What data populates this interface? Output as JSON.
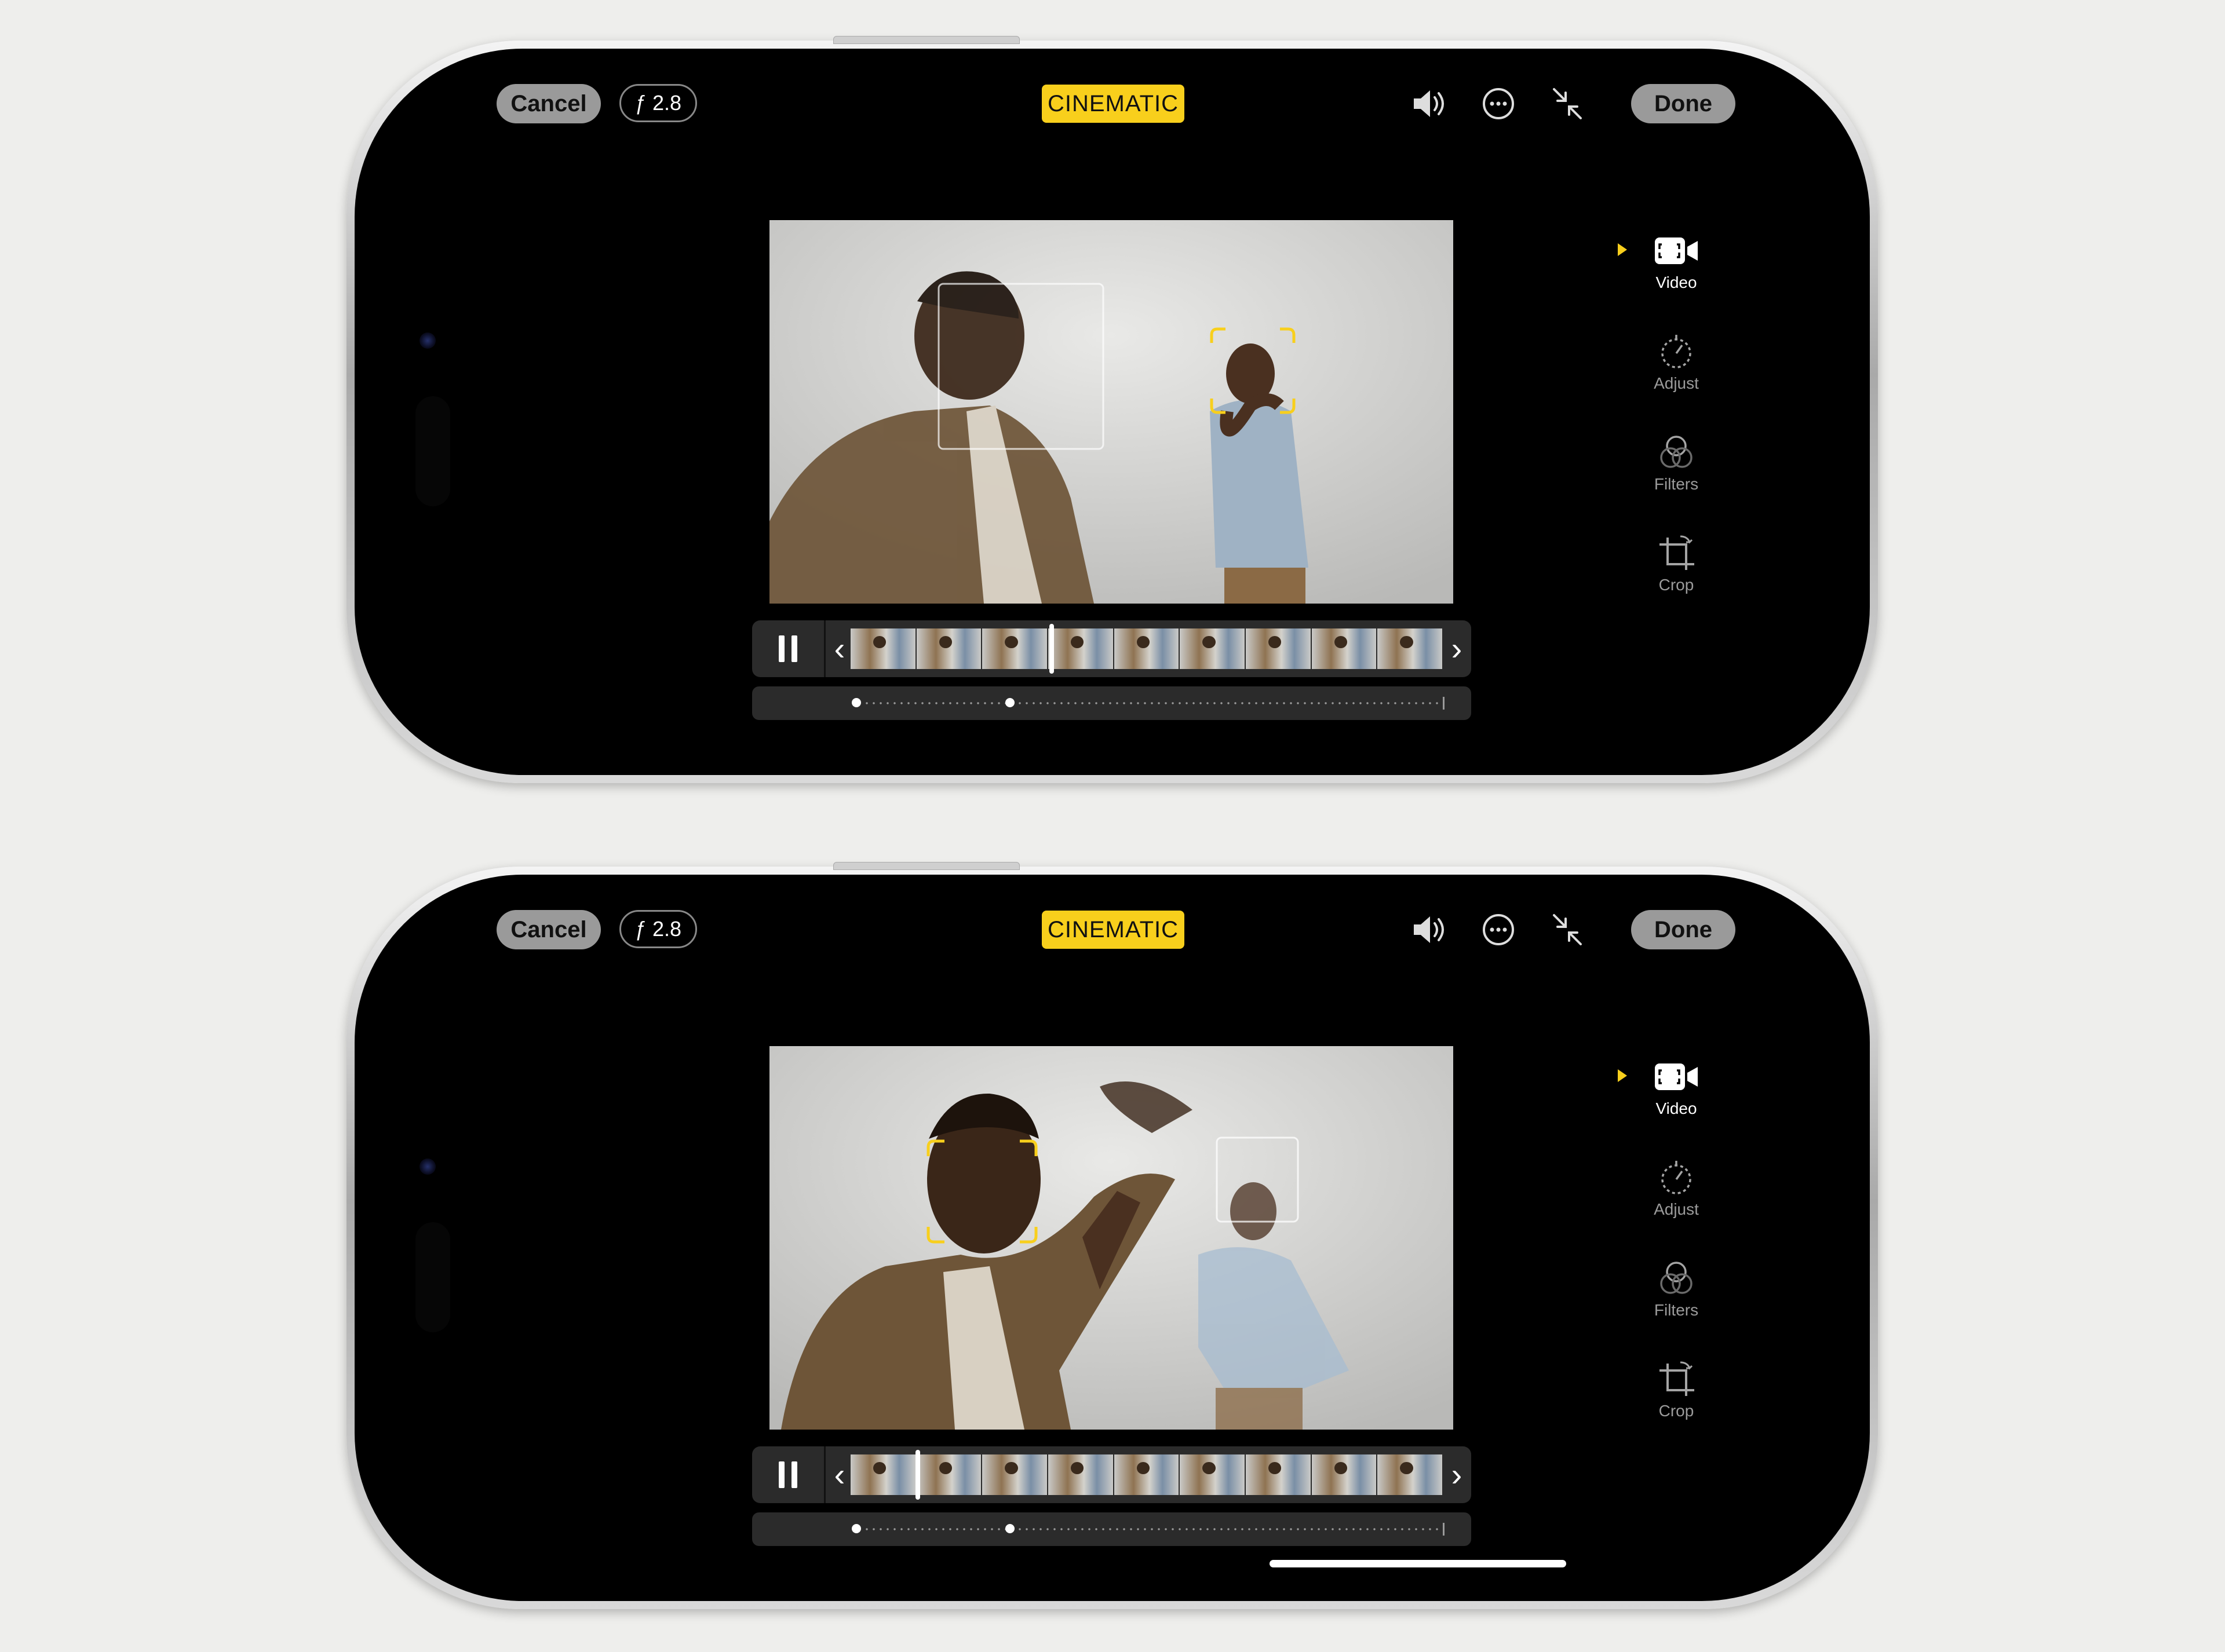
{
  "header": {
    "cancel_label": "Cancel",
    "aperture_label": "ƒ 2.8",
    "mode_label": "CINEMATIC",
    "done_label": "Done",
    "icons": [
      "speaker-icon",
      "more-icon",
      "collapse-icon"
    ]
  },
  "sidebar": {
    "items": [
      {
        "label": "Video",
        "icon": "video-focus-icon",
        "selected": true
      },
      {
        "label": "Adjust",
        "icon": "adjust-dial-icon",
        "selected": false
      },
      {
        "label": "Filters",
        "icon": "filters-icon",
        "selected": false
      },
      {
        "label": "Crop",
        "icon": "crop-rotate-icon",
        "selected": false
      }
    ]
  },
  "colors": {
    "accent": "#f8cf1c",
    "screen_bg": "#000000",
    "button_bg": "#9a9a9a",
    "page_bg": "#eeeeec"
  },
  "screens": [
    {
      "focus_subject": "background-person",
      "playhead_fraction": 0.33
    },
    {
      "focus_subject": "foreground-person",
      "playhead_fraction": 0.12
    }
  ]
}
